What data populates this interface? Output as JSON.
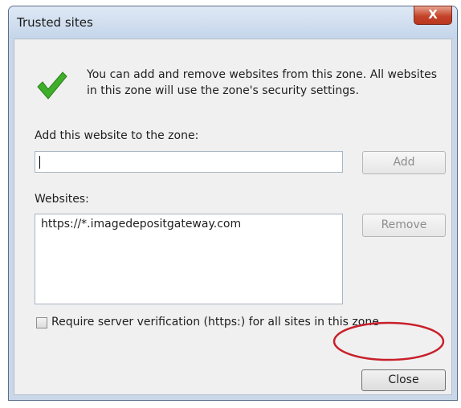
{
  "window": {
    "title": "Trusted sites",
    "close_glyph": "X"
  },
  "info": {
    "message": "You can add and remove websites from this zone. All websites in this zone will use the zone's security settings.",
    "icon": "checkmark-icon"
  },
  "add_section": {
    "label": "Add this website to the zone:",
    "input_value": "",
    "add_button": "Add"
  },
  "websites": {
    "label": "Websites:",
    "items": [
      "https://*.imagedepositgateway.com"
    ],
    "remove_button": "Remove"
  },
  "verification": {
    "checked": false,
    "label": "Require server verification (https:) for all sites in this zone"
  },
  "footer": {
    "close_button": "Close"
  },
  "colors": {
    "accent_check": "#3fae2a",
    "close_x": "#c4432a",
    "highlight": "#c8202a"
  }
}
